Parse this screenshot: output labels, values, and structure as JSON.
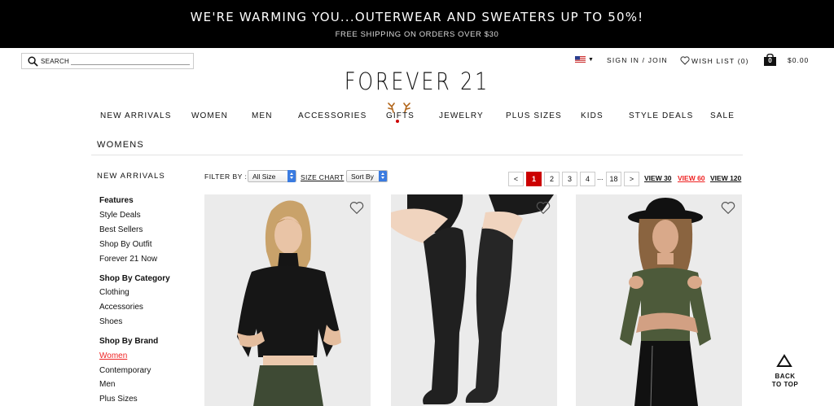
{
  "promo": {
    "headline": "WE'RE WARMING YOU...OUTERWEAR AND SWEATERS UP TO 50%!",
    "subline": "FREE SHIPPING ON ORDERS OVER $30"
  },
  "header": {
    "search_label": "SEARCH",
    "sign_in": "SIGN IN / JOIN",
    "wish_list": "WISH LIST (0)",
    "bag_count": "0",
    "cart_total": "$0.00",
    "logo": "FOREVER 21"
  },
  "nav": [
    "NEW ARRIVALS",
    "WOMEN",
    "MEN",
    "ACCESSORIES",
    "GIFTS",
    "JEWELRY",
    "PLUS SIZES",
    "KIDS",
    "STYLE DEALS",
    "SALE"
  ],
  "section_title": "WOMENS",
  "sidebar": {
    "top_link": "NEW ARRIVALS",
    "groups": [
      {
        "heading": "Features",
        "links": [
          "Style Deals",
          "Best Sellers",
          "Shop By Outfit",
          "Forever 21 Now"
        ]
      },
      {
        "heading": "Shop By Category",
        "links": [
          "Clothing",
          "Accessories",
          "Shoes"
        ]
      },
      {
        "heading": "Shop By Brand",
        "links": [
          "Women",
          "Contemporary",
          "Men",
          "Plus Sizes"
        ],
        "active": "Women"
      }
    ]
  },
  "toolbar": {
    "filter_label": "FILTER BY :",
    "size_select": "All Size",
    "size_chart": "SIZE CHART",
    "sort_select": "Sort By"
  },
  "pagination": {
    "prev": "<",
    "pages": [
      "1",
      "2",
      "3",
      "4"
    ],
    "current": "1",
    "ellipsis": "...",
    "last": "18",
    "next": ">",
    "view_options": [
      "VIEW 30",
      "VIEW 60",
      "VIEW 120"
    ],
    "view_active": "VIEW 60"
  },
  "products": [
    {
      "image": "black-turtleneck-crop-top"
    },
    {
      "image": "black-over-the-knee-boots"
    },
    {
      "image": "olive-cold-shoulder-top"
    }
  ],
  "back_to_top": [
    "BACK",
    "TO TOP"
  ],
  "colors": {
    "promo_bg": "#000000",
    "accent_red": "#cc0000",
    "link_red": "#ee2222",
    "select_blue": "#3a7be0",
    "card_bg": "#ebebeb"
  },
  "icons": {
    "search": "search-icon",
    "flag": "us-flag-icon",
    "wishlist": "heart-icon",
    "bag": "shopping-bag-icon",
    "favorite": "heart-outline-icon",
    "back_to_top": "triangle-up-icon"
  }
}
